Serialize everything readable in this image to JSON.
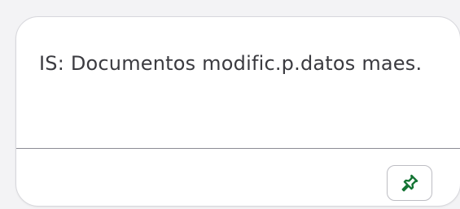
{
  "tile": {
    "title": "IS: Documentos modific.p.datos maes."
  },
  "actions": {
    "pin_icon": "pin-icon",
    "pin_color": "#137333"
  }
}
